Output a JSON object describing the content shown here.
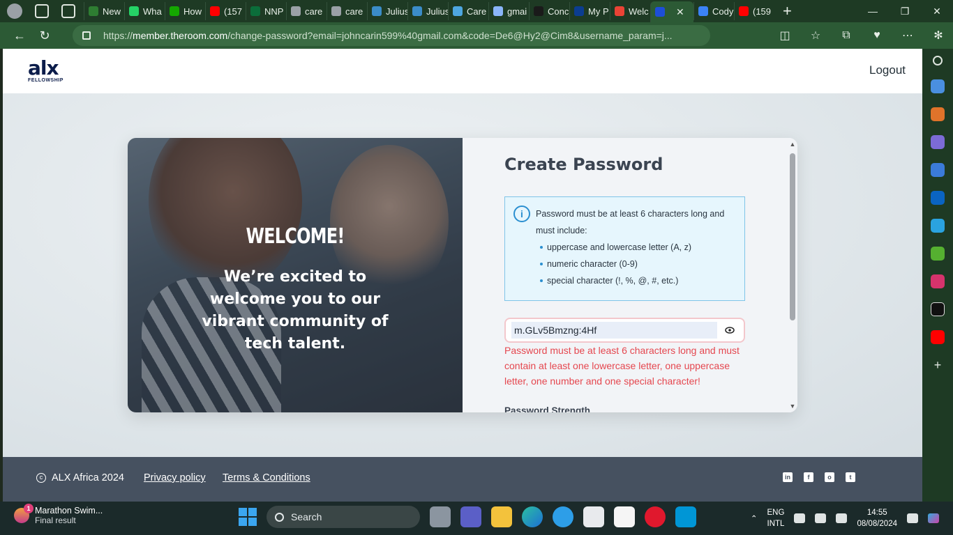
{
  "browser": {
    "tabs": [
      {
        "label": "New",
        "color": "#2e7d32"
      },
      {
        "label": "Wha",
        "color": "#25d366"
      },
      {
        "label": "How",
        "color": "#14a800"
      },
      {
        "label": "(157",
        "color": "#ff0000"
      },
      {
        "label": "NNP",
        "color": "#0b6d3a"
      },
      {
        "label": "care",
        "color": "#9aa0a6"
      },
      {
        "label": "care",
        "color": "#9aa0a6"
      },
      {
        "label": "Julius",
        "color": "#3b8cc8"
      },
      {
        "label": "Julius",
        "color": "#3b8cc8"
      },
      {
        "label": "Care",
        "color": "#4ea6e0"
      },
      {
        "label": "gmai",
        "color": "#8ab4f8"
      },
      {
        "label": "Conc",
        "color": "#1a1a1a"
      },
      {
        "label": "My P",
        "color": "#0b3d91"
      },
      {
        "label": "Welc",
        "color": "#ea4335"
      },
      {
        "label": "",
        "color": "#1d4ed8"
      },
      {
        "label": "Cody",
        "color": "#3b82f6"
      },
      {
        "label": "(159",
        "color": "#ff0000"
      }
    ],
    "url_host": "member.theroom.com",
    "url_prefix": "https://",
    "url_rest": "/change-password?email=johncarin599%40gmail.com&code=De6@Hy2@Cim8&username_param=j..."
  },
  "site": {
    "logo_text": "alx",
    "logo_sub": "FELLOWSHIP",
    "logout_label": "Logout"
  },
  "hero": {
    "welcome": "WELCOME!",
    "message": "We’re excited to welcome you to our vibrant community of tech talent."
  },
  "form": {
    "title": "Create Password",
    "info_intro": "Password must be at least 6 characters long and must include:",
    "requirements": [
      "uppercase and lowercase letter (A, z)",
      "numeric character (0-9)",
      "special character (!, %, @, #, etc.)"
    ],
    "password_value": "m.GLv5Bmzng:4Hf",
    "error_message": "Password must be at least 6 characters long and must contain at least one lowercase letter, one uppercase letter, one number and one special character!",
    "strength_label": "Password Strength"
  },
  "footer": {
    "copyright": "ALX Africa 2024",
    "privacy_label": "Privacy policy",
    "terms_label": "Terms & Conditions",
    "social": [
      "linkedin-icon",
      "facebook-icon",
      "instagram-icon",
      "twitter-icon"
    ]
  },
  "taskbar": {
    "notification_title": "Marathon Swim...",
    "notification_sub": "Final result",
    "notification_count": "1",
    "search_label": "Search",
    "lang_line1": "ENG",
    "lang_line2": "INTL",
    "time": "14:55",
    "date": "08/08/2024"
  }
}
